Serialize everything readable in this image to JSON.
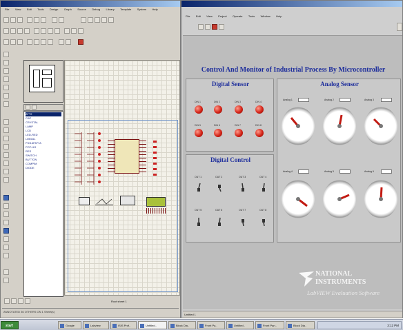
{
  "isis": {
    "menu": [
      "File",
      "View",
      "Edit",
      "Tools",
      "Design",
      "Graph",
      "Source",
      "Debug",
      "Library",
      "Template",
      "System",
      "Help"
    ],
    "device_list": [
      "ATT2"
    ],
    "device_items": [
      "ATT2",
      "CAP",
      "CRYSTAL",
      "LAMP",
      "LCD",
      "LED-RED",
      "LM016L",
      "PIC16F877A",
      "POT-HG",
      "RES",
      "SWITCH",
      "BUTTON",
      "COMPIM",
      "DIODE"
    ],
    "sheet_label": "Root sheet 1",
    "status_text": "ANNOTATED 36 OTHERS ON 1 Sheet(s)"
  },
  "labview": {
    "menu": [
      "File",
      "Edit",
      "View",
      "Project",
      "Operate",
      "Tools",
      "Window",
      "Help"
    ],
    "heading": "Control And Monitor of Industrial Process By Microcontroller",
    "digital_sensor_title": "Digital Sensor",
    "digital_control_title": "Digital Control",
    "analog_sensor_title": "Analog Sensor",
    "led_labels": [
      "DIN 1",
      "DIN 2",
      "DIN 3",
      "DIN 4",
      "DIN 5",
      "DIN 6",
      "DIN 7",
      "DIN 8"
    ],
    "switch_labels": [
      "OUT 1",
      "OUT 2",
      "OUT 3",
      "OUT 4",
      "OUT 5",
      "OUT 6",
      "OUT 7",
      "OUT 8"
    ],
    "gauge_labels": [
      "Analog 1",
      "Analog 2",
      "Analog 3",
      "Analog 4",
      "Analog 5",
      "Analog 6"
    ],
    "ni_line1": "NATIONAL",
    "ni_line2": "INSTRUMENTS",
    "ni_line3": "LabVIEW Evaluation Software",
    "status_tab": "Untitled 1"
  },
  "taskbar": {
    "start": "start",
    "items": [
      "Google",
      "Labview",
      "ISIS Prof..",
      "Untitled..",
      "Block Dia..",
      "Front Pa..",
      "Untitled..",
      "Front Pan..",
      "Block Dia.."
    ],
    "clock": "3:12 PM"
  },
  "colors": {
    "led_on": "#d42418",
    "heading_blue": "#1e2e9c",
    "titlebar": "#0a246a"
  }
}
